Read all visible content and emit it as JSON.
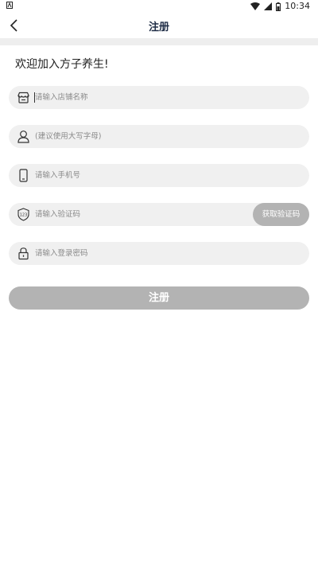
{
  "status_bar": {
    "time": "10:34"
  },
  "nav": {
    "title": "注册"
  },
  "welcome_text": "欢迎加入方子养生!",
  "fields": {
    "store_name": {
      "placeholder": "请输入店铺名称",
      "icon": "storefront-icon"
    },
    "name": {
      "placeholder": "(建议使用大写字母)",
      "icon": "user-icon"
    },
    "phone": {
      "placeholder": "请输入手机号",
      "icon": "phone-icon"
    },
    "code": {
      "placeholder": "请输入验证码",
      "icon": "shield-123-icon",
      "button_label": "获取验证码"
    },
    "password": {
      "placeholder": "请输入登录密码",
      "icon": "lock-icon"
    }
  },
  "submit_label": "注册",
  "colors": {
    "title": "#1f2d46",
    "field_bg": "#f0f0f0",
    "button_bg": "#b3b3b3"
  }
}
